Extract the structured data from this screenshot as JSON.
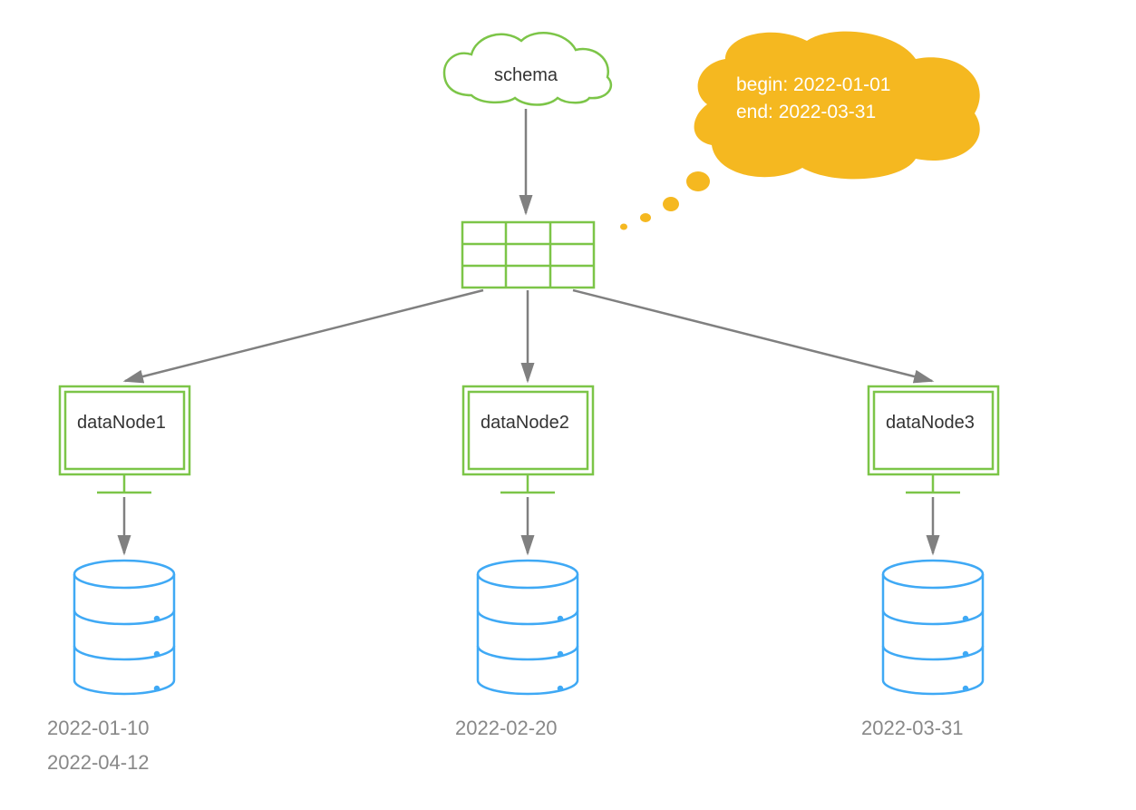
{
  "schema": {
    "label": "schema"
  },
  "callout": {
    "line1": "begin: 2022-01-01",
    "line2": "end: 2022-03-31"
  },
  "nodes": [
    {
      "label": "dataNode1",
      "dates": [
        "2022-01-10",
        "2022-04-12"
      ]
    },
    {
      "label": "dataNode2",
      "dates": [
        "2022-02-20"
      ]
    },
    {
      "label": "dataNode3",
      "dates": [
        "2022-03-31"
      ]
    }
  ],
  "colors": {
    "green": "#7cc548",
    "blue": "#3fa9f5",
    "orange": "#f5b820",
    "gray": "#808080"
  }
}
